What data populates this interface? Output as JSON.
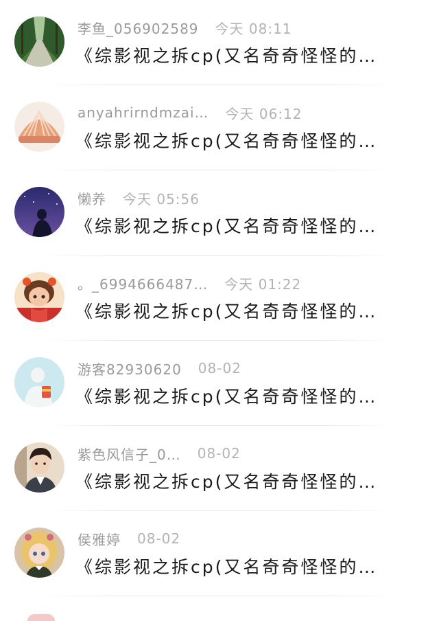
{
  "conversations": [
    {
      "name": "李鱼_056902589",
      "time": "今天 08:11",
      "message": "《综影视之拆cp(又名奇奇怪怪的…",
      "avatar_icon": "forest-road-avatar",
      "avatar_colors": [
        "#2f5a2c",
        "#8fb27a"
      ]
    },
    {
      "name": "anyahrirndmzai…",
      "time": "今天 06:12",
      "message": "《综影视之拆cp(又名奇奇怪怪的…",
      "avatar_icon": "seashell-avatar",
      "avatar_colors": [
        "#e8b08c",
        "#f6dcc7"
      ]
    },
    {
      "name": "懒养",
      "time": "今天 05:56",
      "message": "《综影视之拆cp(又名奇奇怪怪的…",
      "avatar_icon": "night-sky-silhouette-avatar",
      "avatar_colors": [
        "#2a2a6e",
        "#5e4f9e"
      ]
    },
    {
      "name": "。_6994666487…",
      "time": "今天 01:22",
      "message": "《综影视之拆cp(又名奇奇怪怪的…",
      "avatar_icon": "cartoon-girl-avatar",
      "avatar_colors": [
        "#c8302b",
        "#f3c7a8"
      ]
    },
    {
      "name": "游客82930620",
      "time": "08-02",
      "message": "《综影视之拆cp(又名奇奇怪怪的…",
      "avatar_icon": "girl-with-snack-avatar",
      "avatar_colors": [
        "#a9dbe6",
        "#ffffff"
      ]
    },
    {
      "name": "紫色风信子_0…",
      "time": "08-02",
      "message": "《综影视之拆cp(又名奇奇怪怪的…",
      "avatar_icon": "young-man-portrait-avatar",
      "avatar_colors": [
        "#5a4638",
        "#e9d9c6"
      ]
    },
    {
      "name": "侯雅婷",
      "time": "08-02",
      "message": "《综影视之拆cp(又名奇奇怪怪的…",
      "avatar_icon": "anime-doll-avatar",
      "avatar_colors": [
        "#e7c36a",
        "#2f3a2a"
      ]
    }
  ]
}
